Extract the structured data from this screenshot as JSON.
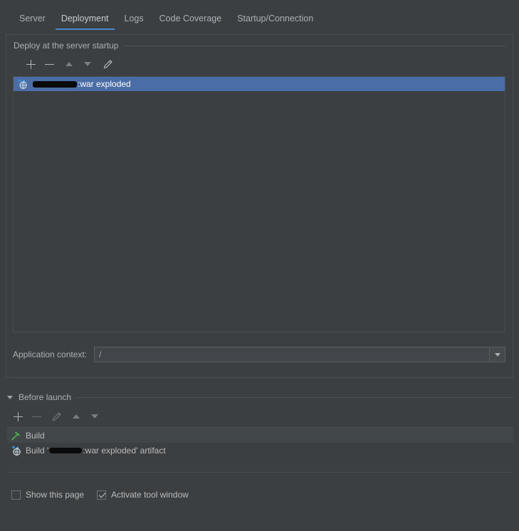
{
  "tabs": [
    {
      "label": "Server",
      "active": false
    },
    {
      "label": "Deployment",
      "active": true
    },
    {
      "label": "Logs",
      "active": false
    },
    {
      "label": "Code Coverage",
      "active": false
    },
    {
      "label": "Startup/Connection",
      "active": false
    }
  ],
  "deployment": {
    "group_title": "Deploy at the server startup",
    "toolbar": {
      "add_label": "+",
      "remove_label": "−",
      "move_up_label": "Move Up",
      "move_down_label": "Move Down",
      "edit_label": "Edit"
    },
    "artifacts": [
      {
        "icon": "artifact-icon",
        "prefix": "",
        "redacted": true,
        "suffix": ":war exploded",
        "selected": true
      }
    ],
    "app_context": {
      "label": "Application context:",
      "value": "/"
    }
  },
  "before_launch": {
    "title": "Before launch",
    "expanded": true,
    "toolbar": {
      "add_label": "+",
      "remove_label": "−",
      "edit_label": "Edit",
      "move_up_label": "Move Up",
      "move_down_label": "Move Down"
    },
    "tasks": [
      {
        "icon": "build-hammer-icon",
        "prefix": "Build",
        "redacted": false,
        "suffix": ""
      },
      {
        "icon": "artifact-icon",
        "prefix": "Build '",
        "redacted": true,
        "suffix": ":war exploded' artifact"
      }
    ]
  },
  "options": [
    {
      "label": "Show this page",
      "checked": false
    },
    {
      "label": "Activate tool window",
      "checked": true
    }
  ],
  "colors": {
    "background": "#3c3f41",
    "selection": "#4a6da7",
    "tab_accent": "#4a88c7",
    "text": "#bbbbbb",
    "muted_text": "#a9b0b6",
    "border": "#4a4d4f",
    "hammer_green": "#4aa84a",
    "artifact_blue": "#3592e0"
  }
}
